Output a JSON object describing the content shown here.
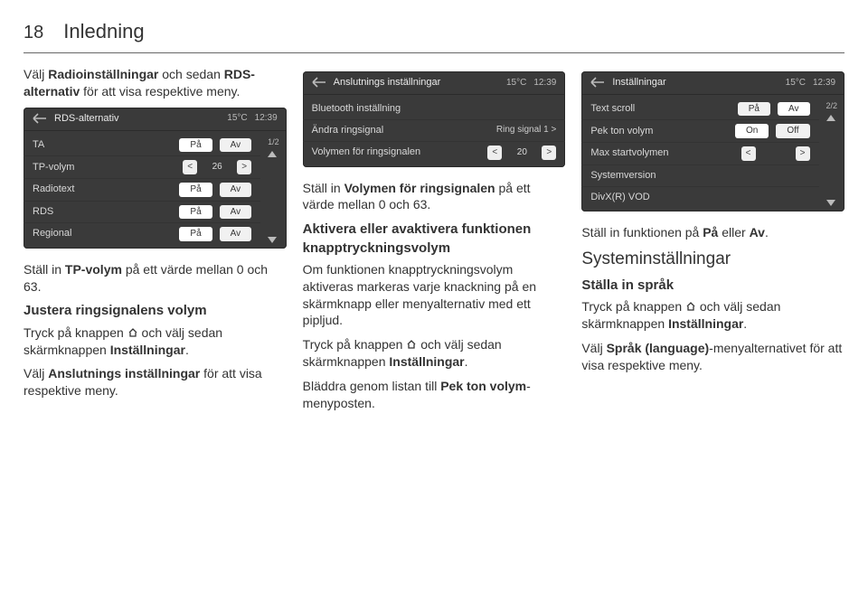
{
  "page": {
    "number": "18",
    "title": "Inledning"
  },
  "col1": {
    "intro_a": "Välj ",
    "intro_b": "Radioinställningar",
    "intro_c": " och sedan ",
    "intro_d": "RDS-alternativ",
    "intro_e": " för att visa respektive meny.",
    "tp_a": "Ställ in ",
    "tp_b": "TP-volym",
    "tp_c": "  på ett värde mellan 0 och 63.",
    "ring_h": "Justera ringsignalens volym",
    "ring_a": "Tryck på knappen ",
    "ring_b": " och välj sedan skärmknappen ",
    "ring_c": "Inställningar",
    "ring_d": ".",
    "ans_a": "Välj ",
    "ans_b": "Anslutnings inställningar",
    "ans_c": " för att visa respektive meny."
  },
  "ui_rds": {
    "title": "RDS-alternativ",
    "temp": "15°C",
    "time": "12:39",
    "page": "1/2",
    "rows": [
      {
        "label": "TA",
        "on": "På",
        "off": "Av"
      },
      {
        "label": "TP-volym",
        "val": "26"
      },
      {
        "label": "Radiotext",
        "on": "På",
        "off": "Av"
      },
      {
        "label": "RDS",
        "on": "På",
        "off": "Av"
      },
      {
        "label": "Regional",
        "on": "På",
        "off": "Av"
      }
    ]
  },
  "ui_conn": {
    "title": "Anslutnings inställningar",
    "temp": "15°C",
    "time": "12:39",
    "rows": [
      {
        "label": "Bluetooth inställning"
      },
      {
        "label": "Ändra ringsignal",
        "right": "Ring signal 1 >"
      },
      {
        "label": "Volymen för ringsignalen",
        "val": "20"
      }
    ]
  },
  "ui_set": {
    "title": "Inställningar",
    "temp": "15°C",
    "time": "12:39",
    "page": "2/2",
    "rows": [
      {
        "label": "Text scroll",
        "on": "På",
        "off": "Av"
      },
      {
        "label": "Pek ton volym",
        "on": "On",
        "off": "Off"
      },
      {
        "label": "Max startvolymen",
        "val": ""
      },
      {
        "label": "Systemversion"
      },
      {
        "label": "DivX(R) VOD"
      }
    ]
  },
  "col2": {
    "vol_a": "Ställ in ",
    "vol_b": "Volymen för ringsignalen",
    "vol_c": " på ett värde mellan 0 och 63.",
    "akt_h1": "Aktivera eller avaktivera funktionen knapptryckningsvolym",
    "akt_p": "Om funktionen knapptryckningsvolym aktiveras markeras varje knackning på en skärmknapp eller menyalternativ med ett pipljud.",
    "akt_a": "Tryck på knappen ",
    "akt_b": " och välj sedan skärmknappen ",
    "akt_c": "Inställningar",
    "akt_d": ".",
    "bl_a": "Bläddra genom listan till ",
    "bl_b": "Pek ton volym",
    "bl_c": "-menyposten."
  },
  "col3": {
    "fn_a": "Ställ in funktionen på ",
    "fn_b": "På",
    "fn_c": " eller ",
    "fn_d": "Av",
    "fn_e": ".",
    "sys_h": "Systeminställningar",
    "lang_h": "Ställa in språk",
    "lang_a": "Tryck på knappen ",
    "lang_b": " och välj sedan skärmknappen ",
    "lang_c": "Inställningar",
    "lang_d": ".",
    "sp_a": "Välj ",
    "sp_b": "Språk (language)",
    "sp_c": "-menyalternativet för att visa respektive meny."
  }
}
